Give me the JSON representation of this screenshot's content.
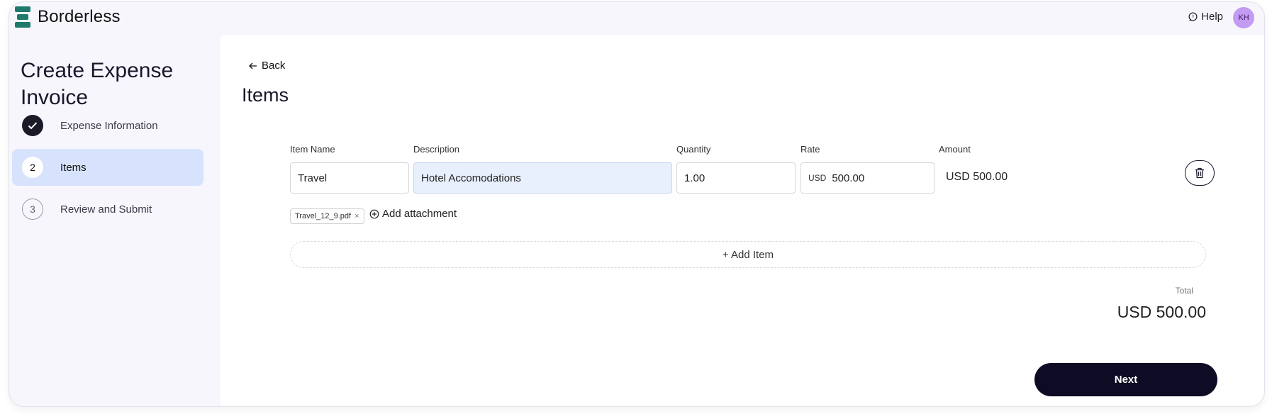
{
  "app": {
    "brand": "Borderless",
    "help_label": "Help",
    "avatar_initials": "KH",
    "brand_color": "#1f7a6c",
    "avatar_color": "#c39bf3"
  },
  "sidebar": {
    "title": "Create Expense Invoice",
    "steps": [
      {
        "number": "",
        "label": "Expense Information",
        "state": "done"
      },
      {
        "number": "2",
        "label": "Items",
        "state": "current"
      },
      {
        "number": "3",
        "label": "Review and Submit",
        "state": "todo"
      }
    ]
  },
  "main": {
    "back_label": "Back",
    "section_title": "Items",
    "columns": {
      "item_name": "Item Name",
      "description": "Description",
      "quantity": "Quantity",
      "rate": "Rate",
      "amount": "Amount"
    },
    "items": [
      {
        "item_name": "Travel",
        "description": "Hotel Accomodations",
        "quantity": "1.00",
        "rate_currency": "USD",
        "rate": "500.00",
        "amount": "USD 500.00",
        "attachment": "Travel_12_9.pdf"
      }
    ],
    "add_attachment_label": "Add attachment",
    "add_item_label": "+ Add Item",
    "total_label": "Total",
    "total_value": "USD 500.00",
    "next_label": "Next",
    "next_color": "#0d0c24",
    "active_step_color": "#d7e3fc"
  }
}
